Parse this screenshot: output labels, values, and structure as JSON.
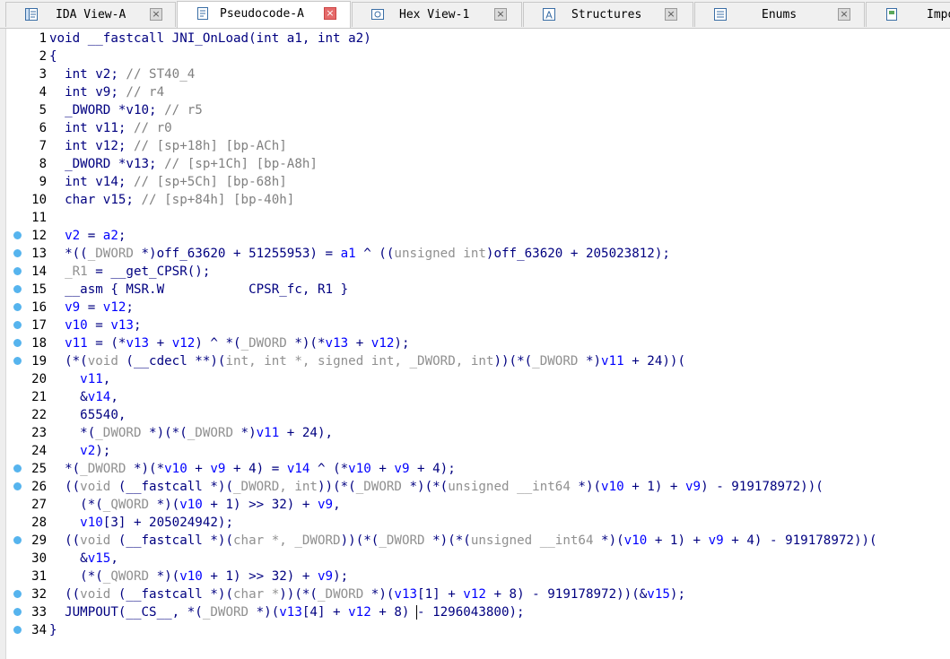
{
  "tabs": [
    {
      "label": "IDA View-A",
      "icon": "disassembly-icon",
      "active": false
    },
    {
      "label": "Pseudocode-A",
      "icon": "pseudocode-icon",
      "active": true
    },
    {
      "label": "Hex View-1",
      "icon": "hex-view-icon",
      "active": false
    },
    {
      "label": "Structures",
      "icon": "structures-icon",
      "active": false
    },
    {
      "label": "Enums",
      "icon": "enums-icon",
      "active": false
    },
    {
      "label": "Impo",
      "icon": "imports-icon",
      "active": false
    }
  ],
  "close_glyph": "×",
  "breakpoint_color": "#56b4ee",
  "lines": [
    {
      "n": "1",
      "dot": false,
      "t": [
        [
          "k",
          "void __fastcall JNI_OnLoad(int a1, int a2)"
        ]
      ]
    },
    {
      "n": "2",
      "dot": false,
      "t": [
        [
          "b",
          "{"
        ]
      ]
    },
    {
      "n": "3",
      "dot": false,
      "t": [
        [
          "k",
          "  int v2; "
        ],
        [
          "c",
          "// ST40_4"
        ]
      ]
    },
    {
      "n": "4",
      "dot": false,
      "t": [
        [
          "k",
          "  int v9; "
        ],
        [
          "c",
          "// r4"
        ]
      ]
    },
    {
      "n": "5",
      "dot": false,
      "t": [
        [
          "k",
          "  _DWORD *v10; "
        ],
        [
          "c",
          "// r5"
        ]
      ]
    },
    {
      "n": "6",
      "dot": false,
      "t": [
        [
          "b",
          "  int v11; "
        ],
        [
          "c",
          "// r0"
        ]
      ]
    },
    {
      "n": "7",
      "dot": false,
      "t": [
        [
          "k",
          "  int v12; "
        ],
        [
          "c",
          "// [sp+18h] [bp-ACh]"
        ]
      ]
    },
    {
      "n": "8",
      "dot": false,
      "t": [
        [
          "k",
          "  _DWORD *v13; "
        ],
        [
          "c",
          "// [sp+1Ch] [bp-A8h]"
        ]
      ]
    },
    {
      "n": "9",
      "dot": false,
      "t": [
        [
          "k",
          "  int v14; "
        ],
        [
          "c",
          "// [sp+5Ch] [bp-68h]"
        ]
      ]
    },
    {
      "n": "10",
      "dot": false,
      "t": [
        [
          "k",
          "  char v15; "
        ],
        [
          "c",
          "// [sp+84h] [bp-40h]"
        ]
      ]
    },
    {
      "n": "11",
      "dot": false,
      "t": [
        [
          "k",
          ""
        ]
      ]
    },
    {
      "n": "12",
      "dot": true,
      "t": [
        [
          "v",
          "  v2"
        ],
        [
          "b",
          " = "
        ],
        [
          "v",
          "a2"
        ],
        [
          "b",
          ";"
        ]
      ]
    },
    {
      "n": "13",
      "dot": true,
      "t": [
        [
          "b",
          "  *(("
        ],
        [
          "g",
          "_DWORD"
        ],
        [
          "b",
          " *)off_63620 + 51255953) = "
        ],
        [
          "v",
          "a1"
        ],
        [
          "b",
          " ^ (("
        ],
        [
          "g",
          "unsigned int"
        ],
        [
          "b",
          ")off_63620 + 205023812);"
        ]
      ]
    },
    {
      "n": "14",
      "dot": true,
      "t": [
        [
          "g",
          "  _R1"
        ],
        [
          "b",
          " = __get_CPSR();"
        ]
      ]
    },
    {
      "n": "15",
      "dot": true,
      "t": [
        [
          "b",
          "  __asm { MSR.W           CPSR_fc, R1 }"
        ]
      ]
    },
    {
      "n": "16",
      "dot": true,
      "t": [
        [
          "v",
          "  v9"
        ],
        [
          "b",
          " = "
        ],
        [
          "v",
          "v12"
        ],
        [
          "b",
          ";"
        ]
      ]
    },
    {
      "n": "17",
      "dot": true,
      "t": [
        [
          "v",
          "  v10"
        ],
        [
          "b",
          " = "
        ],
        [
          "v",
          "v13"
        ],
        [
          "b",
          ";"
        ]
      ]
    },
    {
      "n": "18",
      "dot": true,
      "t": [
        [
          "v",
          "  v11"
        ],
        [
          "b",
          " = (*"
        ],
        [
          "v",
          "v13"
        ],
        [
          "b",
          " + "
        ],
        [
          "v",
          "v12"
        ],
        [
          "b",
          ") ^ *("
        ],
        [
          "g",
          "_DWORD"
        ],
        [
          "b",
          " *)(*"
        ],
        [
          "v",
          "v13"
        ],
        [
          "b",
          " + "
        ],
        [
          "v",
          "v12"
        ],
        [
          "b",
          ");"
        ]
      ]
    },
    {
      "n": "19",
      "dot": true,
      "t": [
        [
          "b",
          "  (*("
        ],
        [
          "g",
          "void"
        ],
        [
          "b",
          " (__cdecl **)("
        ],
        [
          "g",
          "int, int *, signed int, _DWORD, int"
        ],
        [
          "b",
          "))(*("
        ],
        [
          "g",
          "_DWORD"
        ],
        [
          "b",
          " *)"
        ],
        [
          "v",
          "v11"
        ],
        [
          "b",
          " + 24))("
        ]
      ]
    },
    {
      "n": "20",
      "dot": false,
      "t": [
        [
          "v",
          "    v11"
        ],
        [
          "b",
          ","
        ]
      ]
    },
    {
      "n": "21",
      "dot": false,
      "t": [
        [
          "b",
          "    &"
        ],
        [
          "v",
          "v14"
        ],
        [
          "b",
          ","
        ]
      ]
    },
    {
      "n": "22",
      "dot": false,
      "t": [
        [
          "b",
          "    65540,"
        ]
      ]
    },
    {
      "n": "23",
      "dot": false,
      "t": [
        [
          "b",
          "    *("
        ],
        [
          "g",
          "_DWORD"
        ],
        [
          "b",
          " *)(*("
        ],
        [
          "g",
          "_DWORD"
        ],
        [
          "b",
          " *)"
        ],
        [
          "v",
          "v11"
        ],
        [
          "b",
          " + 24),"
        ]
      ]
    },
    {
      "n": "24",
      "dot": false,
      "t": [
        [
          "v",
          "    v2"
        ],
        [
          "b",
          ");"
        ]
      ]
    },
    {
      "n": "25",
      "dot": true,
      "t": [
        [
          "b",
          "  *("
        ],
        [
          "g",
          "_DWORD"
        ],
        [
          "b",
          " *)(*"
        ],
        [
          "v",
          "v10"
        ],
        [
          "b",
          " + "
        ],
        [
          "v",
          "v9"
        ],
        [
          "b",
          " + 4) = "
        ],
        [
          "v",
          "v14"
        ],
        [
          "b",
          " ^ (*"
        ],
        [
          "v",
          "v10"
        ],
        [
          "b",
          " + "
        ],
        [
          "v",
          "v9"
        ],
        [
          "b",
          " + 4);"
        ]
      ]
    },
    {
      "n": "26",
      "dot": true,
      "t": [
        [
          "b",
          "  (("
        ],
        [
          "g",
          "void"
        ],
        [
          "b",
          " (__fastcall *)("
        ],
        [
          "g",
          "_DWORD, int"
        ],
        [
          "b",
          "))(*("
        ],
        [
          "g",
          "_DWORD"
        ],
        [
          "b",
          " *)(*("
        ],
        [
          "g",
          "unsigned __int64"
        ],
        [
          "b",
          " *)("
        ],
        [
          "v",
          "v10"
        ],
        [
          "b",
          " + 1) + "
        ],
        [
          "v",
          "v9"
        ],
        [
          "b",
          ") - 919178972))("
        ]
      ]
    },
    {
      "n": "27",
      "dot": false,
      "t": [
        [
          "b",
          "    (*("
        ],
        [
          "g",
          "_QWORD"
        ],
        [
          "b",
          " *)("
        ],
        [
          "v",
          "v10"
        ],
        [
          "b",
          " + 1) >> 32) + "
        ],
        [
          "v",
          "v9"
        ],
        [
          "b",
          ","
        ]
      ]
    },
    {
      "n": "28",
      "dot": false,
      "t": [
        [
          "v",
          "    v10"
        ],
        [
          "b",
          "[3] + 205024942);"
        ]
      ]
    },
    {
      "n": "29",
      "dot": true,
      "t": [
        [
          "b",
          "  (("
        ],
        [
          "g",
          "void"
        ],
        [
          "b",
          " (__fastcall *)("
        ],
        [
          "g",
          "char *, _DWORD"
        ],
        [
          "b",
          "))(*("
        ],
        [
          "g",
          "_DWORD"
        ],
        [
          "b",
          " *)(*("
        ],
        [
          "g",
          "unsigned __int64"
        ],
        [
          "b",
          " *)("
        ],
        [
          "v",
          "v10"
        ],
        [
          "b",
          " + 1) + "
        ],
        [
          "v",
          "v9"
        ],
        [
          "b",
          " + 4) - 919178972))("
        ]
      ]
    },
    {
      "n": "30",
      "dot": false,
      "t": [
        [
          "b",
          "    &"
        ],
        [
          "v",
          "v15"
        ],
        [
          "b",
          ","
        ]
      ]
    },
    {
      "n": "31",
      "dot": false,
      "t": [
        [
          "b",
          "    (*("
        ],
        [
          "g",
          "_QWORD"
        ],
        [
          "b",
          " *)("
        ],
        [
          "v",
          "v10"
        ],
        [
          "b",
          " + 1) >> 32) + "
        ],
        [
          "v",
          "v9"
        ],
        [
          "b",
          ");"
        ]
      ]
    },
    {
      "n": "32",
      "dot": true,
      "t": [
        [
          "b",
          "  (("
        ],
        [
          "g",
          "void"
        ],
        [
          "b",
          " (__fastcall *)("
        ],
        [
          "g",
          "char *"
        ],
        [
          "b",
          "))(*("
        ],
        [
          "g",
          "_DWORD"
        ],
        [
          "b",
          " *)("
        ],
        [
          "v",
          "v13"
        ],
        [
          "b",
          "[1] + "
        ],
        [
          "v",
          "v12"
        ],
        [
          "b",
          " + 8) - 919178972))(&"
        ],
        [
          "v",
          "v15"
        ],
        [
          "b",
          ");"
        ]
      ]
    },
    {
      "n": "33",
      "dot": true,
      "caret": true,
      "t": [
        [
          "b",
          "  JUMPOUT(__CS__, *("
        ],
        [
          "g",
          "_DWORD"
        ],
        [
          "b",
          " *)("
        ],
        [
          "v",
          "v13"
        ],
        [
          "b",
          "[4] + "
        ],
        [
          "v",
          "v12"
        ],
        [
          "b",
          " + 8) "
        ],
        [
          "caret",
          ""
        ],
        [
          "b",
          "- 1296043800);"
        ]
      ]
    },
    {
      "n": "34",
      "dot": true,
      "t": [
        [
          "b",
          "}"
        ]
      ]
    }
  ]
}
